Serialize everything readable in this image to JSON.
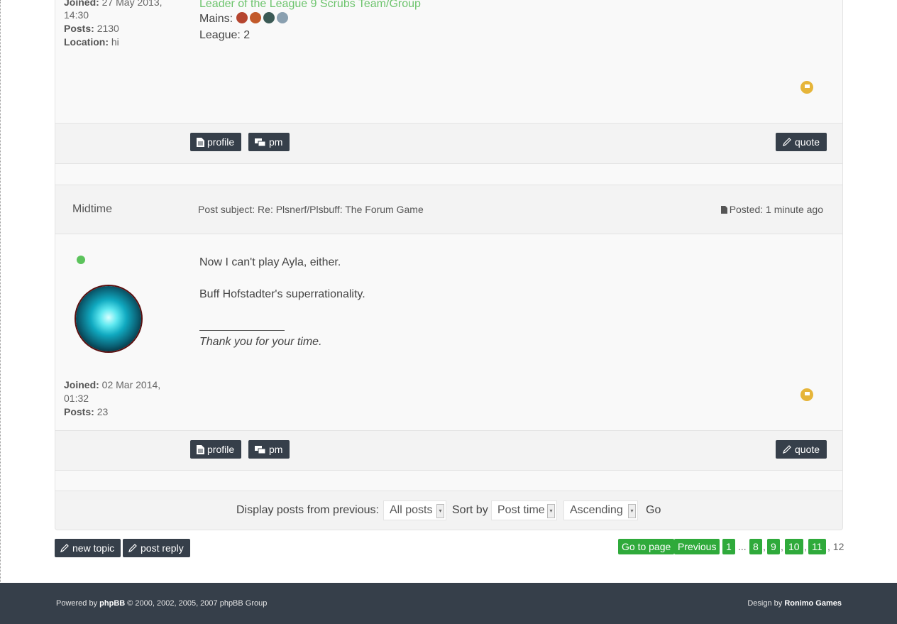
{
  "post1": {
    "joined_label": "Joined:",
    "joined_value": "27 May 2013,",
    "joined_time": "14:30",
    "posts_label": "Posts:",
    "posts_value": "2130",
    "location_label": "Location:",
    "location_value": "hi",
    "signature_leader": "Leader of the League 9 Scrubs Team/Group",
    "mains_label": "Mains:",
    "league_line": "League: 2"
  },
  "post2": {
    "author": "Midtime",
    "subject": "Post subject: Re: Plsnerf/Plsbuff: The Forum Game",
    "posted": "Posted: 1 minute ago",
    "body_line1": "Now I can't play Ayla, either.",
    "body_line2": "Buff Hofstadter's superrationality.",
    "signature": "Thank you for your time.",
    "joined_label": "Joined:",
    "joined_value": "02 Mar 2014,",
    "joined_time": "01:32",
    "posts_label": "Posts:",
    "posts_value": "23"
  },
  "buttons": {
    "profile": "profile",
    "pm": "pm",
    "quote": "quote",
    "new_topic": "new topic",
    "post_reply": "post reply"
  },
  "sort": {
    "display_label": "Display posts from previous:",
    "display_value": "All posts",
    "sort_label": "Sort by",
    "sort_value": "Post time",
    "order_value": "Ascending",
    "go": "Go"
  },
  "pagination": {
    "goto": "Go to page",
    "previous": "Previous",
    "p1": "1",
    "ellipsis": "...",
    "p8": "8",
    "p9": "9",
    "p10": "10",
    "p11": "11",
    "current": "12"
  },
  "footer": {
    "powered_prefix": "Powered by",
    "powered_brand": "phpBB",
    "powered_suffix": "© 2000, 2002, 2005, 2007 phpBB Group",
    "design_prefix": "Design by",
    "design_brand": "Ronimo Games"
  },
  "colors": {
    "accent_green": "#2faa3b",
    "button_dark": "#363f4a",
    "leader_green": "#6dc46d",
    "report_orange": "#e6b53a",
    "online_green": "#5cc35c"
  },
  "icons": [
    "document-icon",
    "chat-icon",
    "pencil-icon",
    "report-flag-icon",
    "post-icon"
  ]
}
